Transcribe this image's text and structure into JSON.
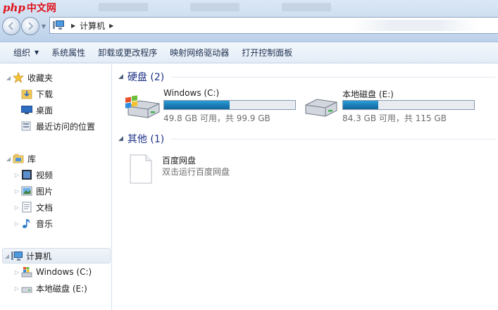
{
  "watermark": {
    "prefix": "php",
    "suffix": "中文网"
  },
  "address": {
    "crumb": "计算机"
  },
  "toolbar": {
    "items": [
      "组织",
      "系统属性",
      "卸载或更改程序",
      "映射网络驱动器",
      "打开控制面板"
    ]
  },
  "nav": {
    "favorites": {
      "label": "收藏夹",
      "items": [
        "下载",
        "桌面",
        "最近访问的位置"
      ]
    },
    "library": {
      "label": "库",
      "items": [
        "视频",
        "图片",
        "文档",
        "音乐"
      ]
    },
    "computer": {
      "label": "计算机",
      "items": [
        "Windows (C:)",
        "本地磁盘 (E:)"
      ]
    }
  },
  "content": {
    "groups": [
      {
        "title": "硬盘 (2)"
      },
      {
        "title": "其他 (1)"
      }
    ],
    "drives": [
      {
        "name": "Windows (C:)",
        "size_text": "49.8 GB 可用，共 99.9 GB",
        "used_fraction": 0.5
      },
      {
        "name": "本地磁盘 (E:)",
        "size_text": "84.3 GB 可用，共 115 GB",
        "used_fraction": 0.27
      }
    ],
    "other": {
      "name": "百度网盘",
      "desc": "双击运行百度网盘"
    }
  },
  "colors": {
    "accent": "#1e3287",
    "bar_fill": "#1c7fb8",
    "watermark": "#e0131b"
  }
}
